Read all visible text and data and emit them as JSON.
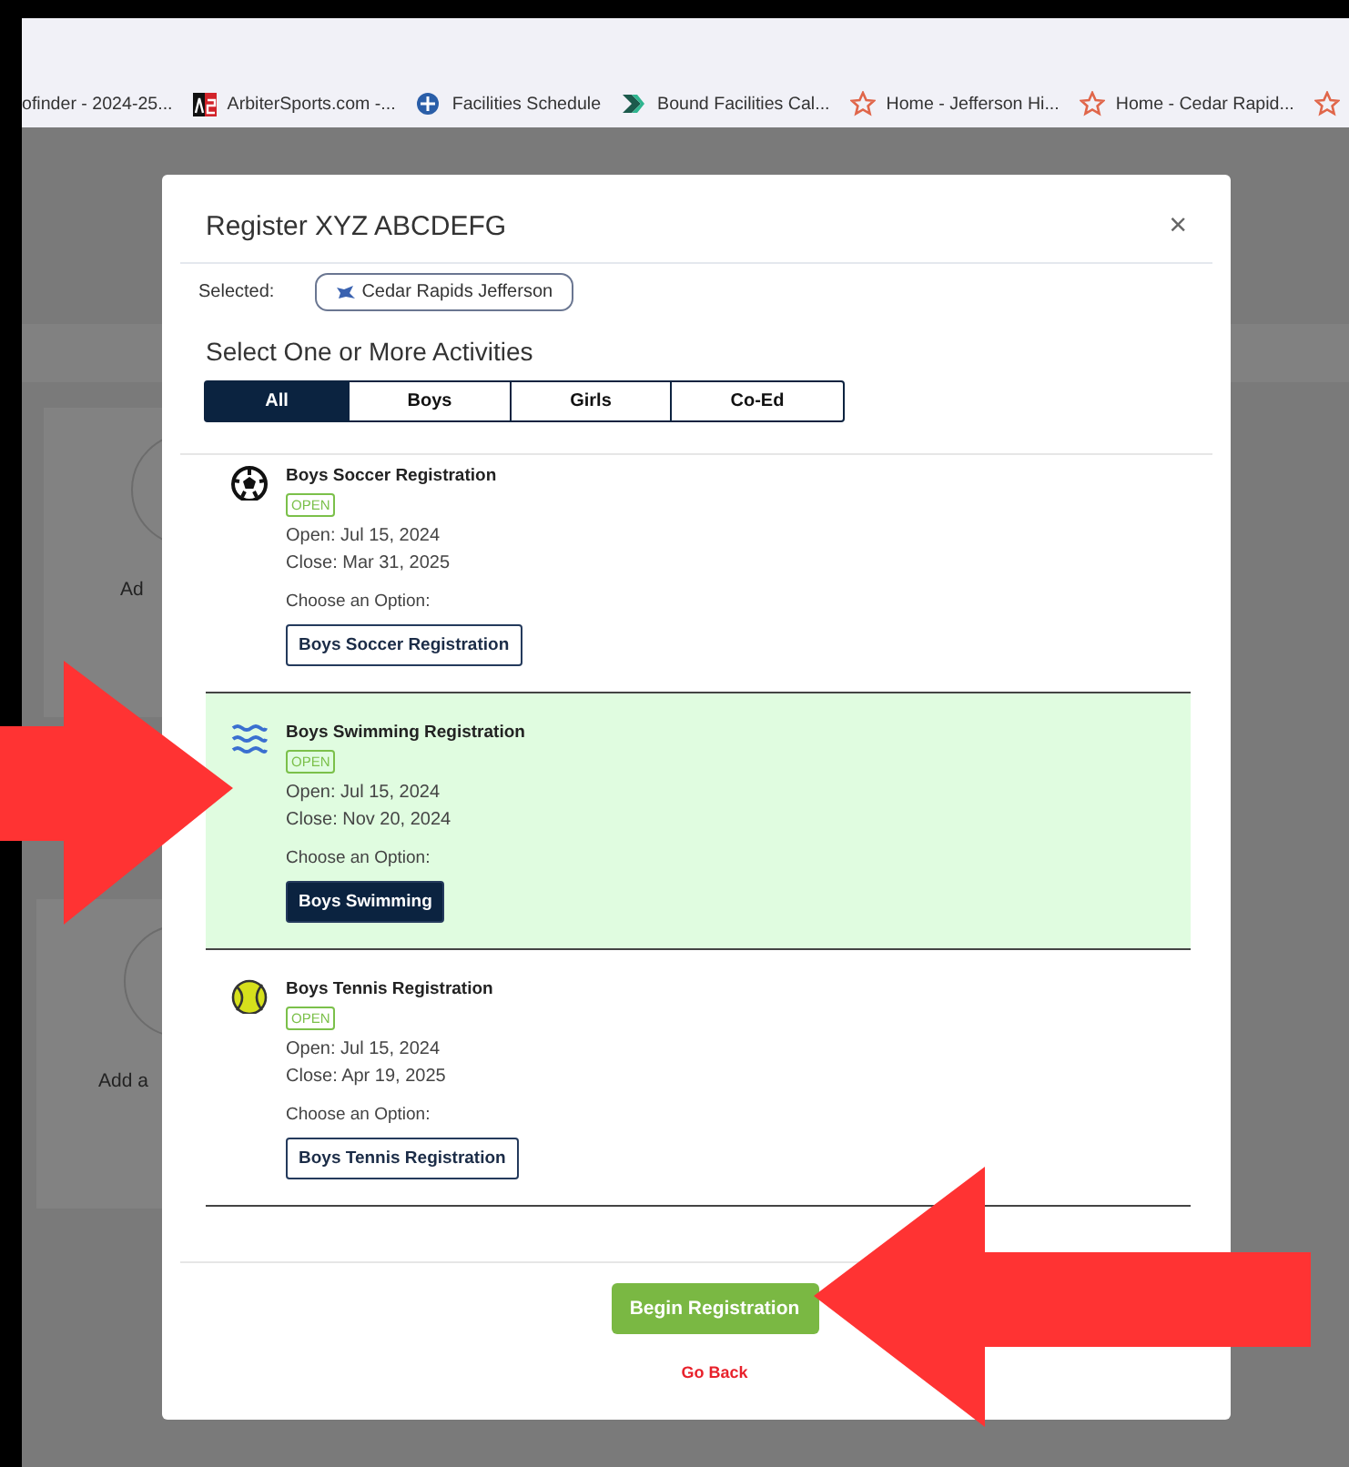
{
  "browser": {
    "bookmarks": [
      {
        "kind": "none",
        "label": "ofinder - 2024-25..."
      },
      {
        "kind": "as",
        "label": "ArbiterSports.com -..."
      },
      {
        "kind": "circle",
        "label": "Facilities Schedule"
      },
      {
        "kind": "chevron",
        "label": "Bound Facilities Cal..."
      },
      {
        "kind": "star",
        "label": "Home - Jefferson Hi..."
      },
      {
        "kind": "star",
        "label": "Home - Cedar Rapid..."
      },
      {
        "kind": "star"
      }
    ]
  },
  "background_page": {
    "card_texts": [
      "Ad",
      "Add a"
    ]
  },
  "modal": {
    "title": "Register XYZ ABCDEFG",
    "close": "×",
    "selected_label": "Selected:",
    "selected_school": "Cedar Rapids Jefferson",
    "heading": "Select One or More Activities",
    "tabs": [
      {
        "label": "All",
        "selected": true
      },
      {
        "label": "Boys",
        "selected": false
      },
      {
        "label": "Girls",
        "selected": false
      },
      {
        "label": "Co-Ed",
        "selected": false
      }
    ],
    "activities": [
      {
        "kind": "soccer",
        "title": "Boys Soccer Registration",
        "status": "OPEN",
        "open": "Open: Jul 15, 2024",
        "close": "Close: Mar 31, 2025",
        "choose": "Choose an Option:",
        "option": {
          "label": "Boys Soccer Registration",
          "selected": false
        },
        "selected": false
      },
      {
        "kind": "swimming",
        "title": "Boys Swimming Registration",
        "status": "OPEN",
        "open": "Open: Jul 15, 2024",
        "close": "Close: Nov 20, 2024",
        "choose": "Choose an Option:",
        "option": {
          "label": "Boys Swimming",
          "selected": true
        },
        "selected": true
      },
      {
        "kind": "tennis",
        "title": "Boys Tennis Registration",
        "status": "OPEN",
        "open": "Open: Jul 15, 2024",
        "close": "Close: Apr 19, 2025",
        "choose": "Choose an Option:",
        "option": {
          "label": "Boys Tennis Registration",
          "selected": false
        },
        "selected": false
      }
    ],
    "primary_button": "Begin Registration",
    "back_link": "Go Back"
  }
}
